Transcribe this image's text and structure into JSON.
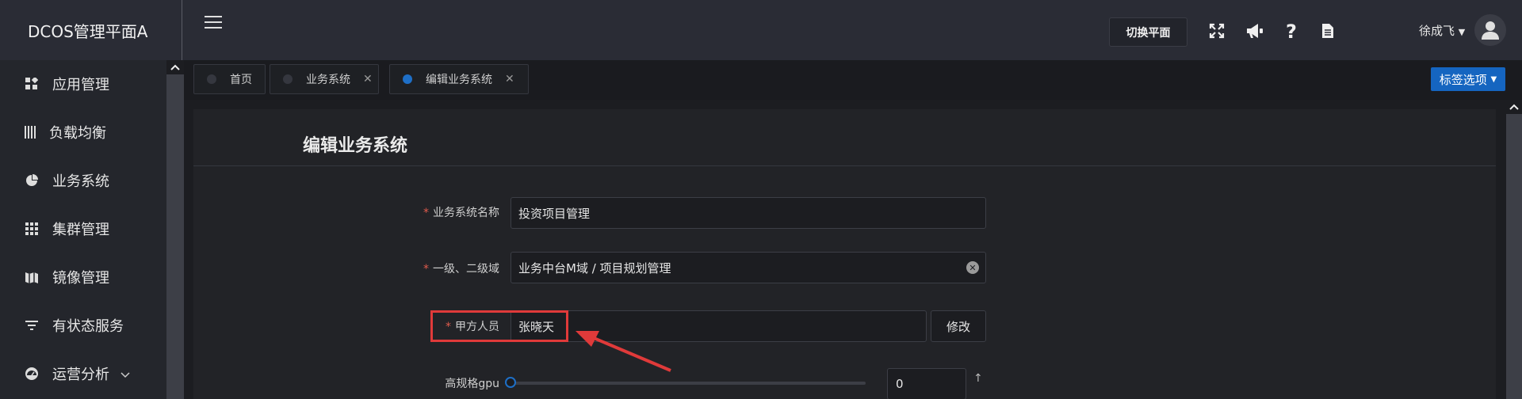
{
  "app": {
    "title": "DCOS管理平面A"
  },
  "header": {
    "switch_label": "切换平面",
    "user_name": "徐成飞",
    "icons": [
      "fullscreen-icon",
      "megaphone-icon",
      "help-icon",
      "document-icon"
    ]
  },
  "sidebar": {
    "items": [
      {
        "label": "应用管理",
        "icon": "app-grid-icon"
      },
      {
        "label": "负载均衡",
        "icon": "bars-icon"
      },
      {
        "label": "业务系统",
        "icon": "pie-icon"
      },
      {
        "label": "集群管理",
        "icon": "dots-grid-icon"
      },
      {
        "label": "镜像管理",
        "icon": "map-icon"
      },
      {
        "label": "有状态服务",
        "icon": "filter-icon"
      },
      {
        "label": "运营分析",
        "icon": "dashboard-icon"
      }
    ]
  },
  "tabs": [
    {
      "label": "首页",
      "closable": false,
      "active": false
    },
    {
      "label": "业务系统",
      "closable": true,
      "active": false
    },
    {
      "label": "编辑业务系统",
      "closable": true,
      "active": true
    }
  ],
  "tag_options_label": "标签选项",
  "form": {
    "title": "编辑业务系统",
    "system_name": {
      "label": "业务系统名称",
      "value": "投资项目管理"
    },
    "domain": {
      "label": "一级、二级域",
      "value": "业务中台M域 / 项目规划管理"
    },
    "party_a": {
      "label": "甲方人员",
      "value": "张晓天",
      "modify_label": "修改"
    },
    "gpu": {
      "label": "高规格gpu",
      "value": "0",
      "slider_fraction": 0
    }
  },
  "colors": {
    "accent": "#1565c0",
    "highlight": "#e03a3a",
    "required": "#e05b4c"
  }
}
